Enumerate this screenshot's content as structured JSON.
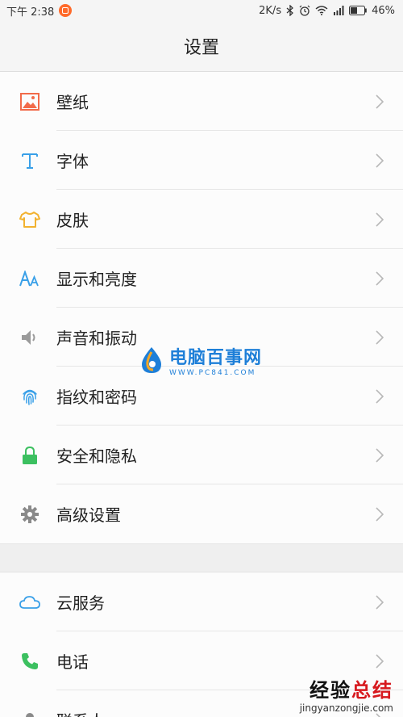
{
  "status": {
    "time": "下午 2:38",
    "speed": "2K/s",
    "battery": "46%"
  },
  "header": {
    "title": "设置"
  },
  "groups": [
    {
      "items": [
        {
          "label": "壁纸",
          "icon": "wallpaper-icon",
          "color": "#f26b4a"
        },
        {
          "label": "字体",
          "icon": "font-icon",
          "color": "#3aa0e8"
        },
        {
          "label": "皮肤",
          "icon": "skin-icon",
          "color": "#f2b230"
        },
        {
          "label": "显示和亮度",
          "icon": "display-brightness-icon",
          "color": "#3aa0e8"
        },
        {
          "label": "声音和振动",
          "icon": "speaker-icon",
          "color": "#9a9a9a"
        },
        {
          "label": "指纹和密码",
          "icon": "fingerprint-icon",
          "color": "#3aa0e8"
        },
        {
          "label": "安全和隐私",
          "icon": "lock-icon",
          "color": "#3cc060"
        },
        {
          "label": "高级设置",
          "icon": "gear-icon",
          "color": "#8a8a8a"
        }
      ]
    },
    {
      "items": [
        {
          "label": "云服务",
          "icon": "cloud-icon",
          "color": "#3aa0e8"
        },
        {
          "label": "电话",
          "icon": "phone-icon",
          "color": "#3cc060"
        },
        {
          "label": "联系人",
          "icon": "contacts-icon",
          "color": "#8a8a8a"
        }
      ]
    }
  ],
  "watermarks": {
    "center_title": "电脑百事网",
    "center_url": "WWW.PC841.COM",
    "corner_title_a": "经验",
    "corner_title_b": "总结",
    "corner_url": "jingyanzongjie.com"
  }
}
